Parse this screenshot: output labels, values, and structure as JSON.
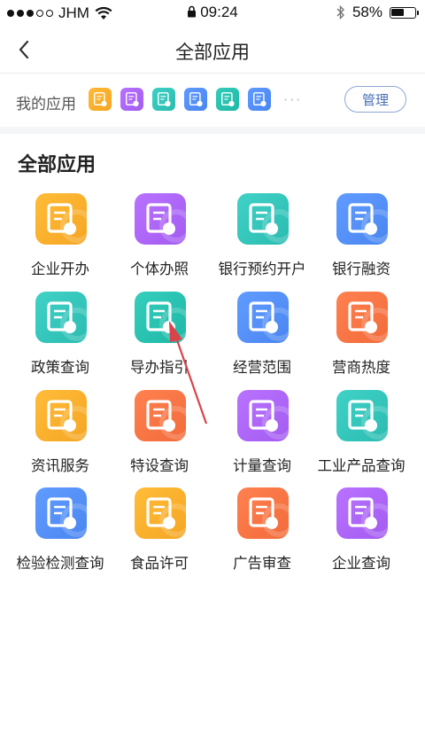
{
  "status_bar": {
    "carrier": "JHM",
    "time": "09:24",
    "battery": "58%",
    "battery_level": 0.58
  },
  "nav": {
    "title": "全部应用",
    "back_icon": "chevron-left-icon"
  },
  "my_apps": {
    "label": "我的应用",
    "more": "···",
    "manage_label": "管理",
    "icons": [
      {
        "icon": "company-icon",
        "color": "#f5a623"
      },
      {
        "icon": "briefcase-icon",
        "color": "#a35cf0"
      },
      {
        "icon": "bank-card-icon",
        "color": "#2bbcb1"
      },
      {
        "icon": "finance-icon",
        "color": "#4a86f0"
      },
      {
        "icon": "guide-icon",
        "color": "#1fb8a6"
      },
      {
        "icon": "policy-icon",
        "color": "#4a86f0"
      }
    ]
  },
  "section_title": "全部应用",
  "apps": [
    {
      "name": "企业开办",
      "icon": "company-icon",
      "color": "#f5a623"
    },
    {
      "name": "个体办照",
      "icon": "briefcase-icon",
      "color": "#a35cf0"
    },
    {
      "name": "银行预约开户",
      "icon": "bank-card-icon",
      "color": "#2bbcb1"
    },
    {
      "name": "银行融资",
      "icon": "finance-icon",
      "color": "#4a86f0"
    },
    {
      "name": "政策查询",
      "icon": "policy-icon",
      "color": "#2bbcb1"
    },
    {
      "name": "导办指引",
      "icon": "guide-icon",
      "color": "#1fb8a6"
    },
    {
      "name": "经营范围",
      "icon": "scope-icon",
      "color": "#4a86f0"
    },
    {
      "name": "营商热度",
      "icon": "store-heat-icon",
      "color": "#f26b3a"
    },
    {
      "name": "资讯服务",
      "icon": "news-icon",
      "color": "#f5a623"
    },
    {
      "name": "特设查询",
      "icon": "special-equipment-icon",
      "color": "#f26b3a"
    },
    {
      "name": "计量查询",
      "icon": "measure-icon",
      "color": "#a35cf0"
    },
    {
      "name": "工业产品查询",
      "icon": "industrial-product-icon",
      "color": "#2bbcb1"
    },
    {
      "name": "检验检测查询",
      "icon": "inspection-icon",
      "color": "#4a86f0"
    },
    {
      "name": "食品许可",
      "icon": "food-license-icon",
      "color": "#f5a623"
    },
    {
      "name": "广告审查",
      "icon": "ad-review-icon",
      "color": "#f26b3a"
    },
    {
      "name": "企业查询",
      "icon": "company-search-icon",
      "color": "#a35cf0"
    }
  ],
  "annotation": {
    "icon": "red-arrow-icon",
    "color": "#d9434a"
  }
}
